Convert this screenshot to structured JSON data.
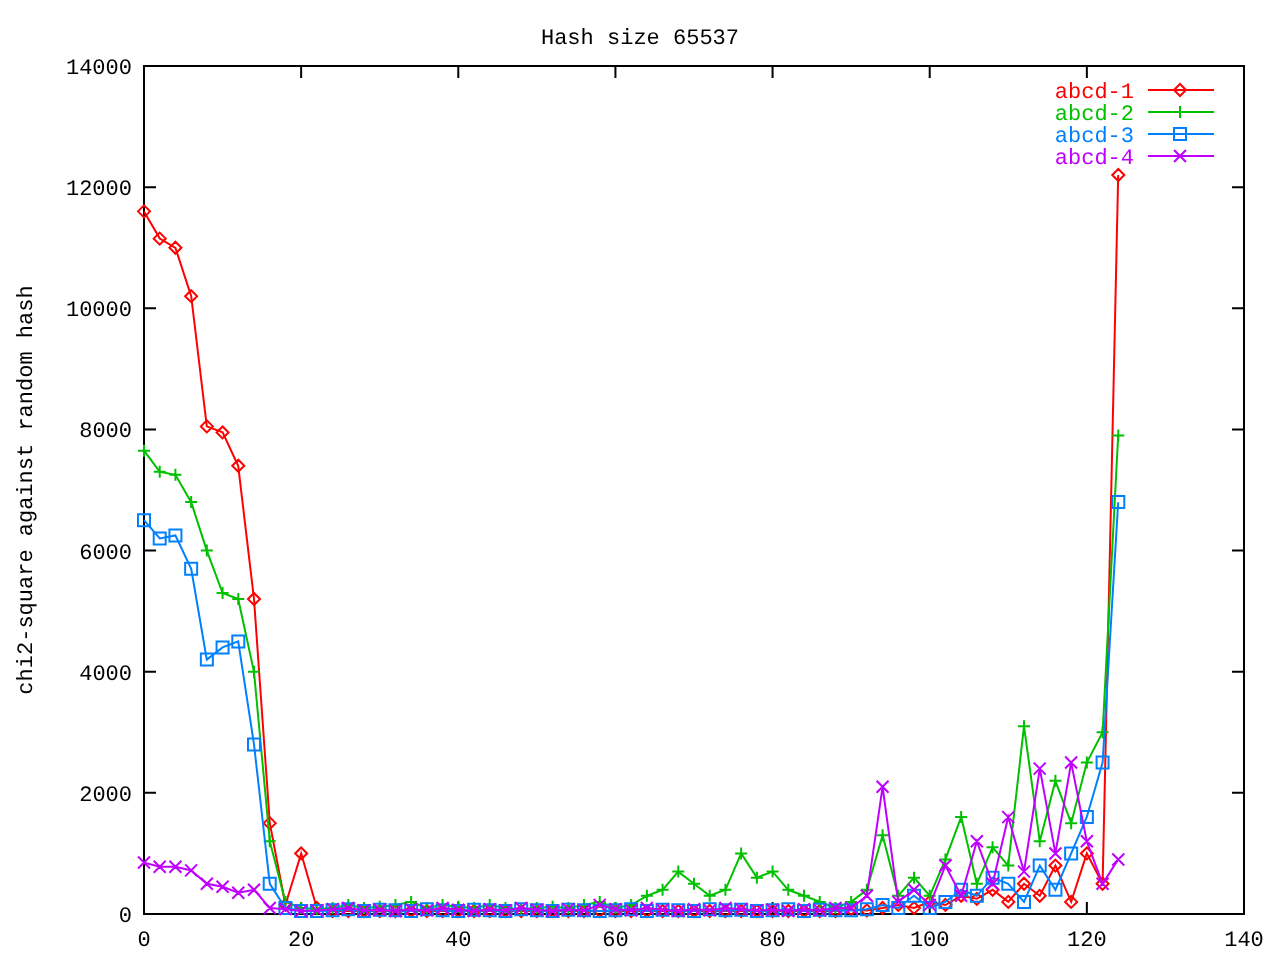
{
  "chart_data": {
    "type": "line",
    "title": "Hash size 65537",
    "ylabel": "chi2-square against random hash",
    "xlim": [
      0,
      140
    ],
    "ylim": [
      0,
      14000
    ],
    "xticks": [
      0,
      20,
      40,
      60,
      80,
      100,
      120,
      140
    ],
    "yticks": [
      0,
      2000,
      4000,
      6000,
      8000,
      10000,
      12000,
      14000
    ],
    "legend": true,
    "x": [
      0,
      2,
      4,
      6,
      8,
      10,
      12,
      14,
      16,
      18,
      20,
      22,
      24,
      26,
      28,
      30,
      32,
      34,
      36,
      38,
      40,
      42,
      44,
      46,
      48,
      50,
      52,
      54,
      56,
      58,
      60,
      62,
      64,
      66,
      68,
      70,
      72,
      74,
      76,
      78,
      80,
      82,
      84,
      86,
      88,
      90,
      92,
      94,
      96,
      98,
      100,
      102,
      104,
      106,
      108,
      110,
      112,
      114,
      116,
      118,
      120,
      122,
      124
    ],
    "series": [
      {
        "name": "abcd-1",
        "color": "#ff0000",
        "marker": "diamond",
        "values": [
          11600,
          11150,
          11000,
          10200,
          8050,
          7950,
          7400,
          5200,
          1500,
          150,
          1000,
          100,
          50,
          50,
          50,
          50,
          50,
          50,
          50,
          50,
          50,
          50,
          50,
          50,
          50,
          50,
          50,
          50,
          50,
          50,
          50,
          50,
          50,
          50,
          50,
          50,
          50,
          50,
          50,
          50,
          50,
          50,
          50,
          50,
          50,
          80,
          60,
          100,
          150,
          100,
          200,
          150,
          300,
          250,
          400,
          200,
          500,
          300,
          800,
          200,
          1000,
          500,
          12200
        ]
      },
      {
        "name": "abcd-2",
        "color": "#00c000",
        "marker": "plus",
        "values": [
          7650,
          7300,
          7250,
          6800,
          6000,
          5300,
          5200,
          4000,
          1200,
          200,
          100,
          80,
          100,
          150,
          100,
          120,
          150,
          200,
          100,
          150,
          120,
          100,
          150,
          100,
          80,
          100,
          120,
          100,
          150,
          200,
          100,
          150,
          300,
          400,
          700,
          500,
          300,
          400,
          1000,
          600,
          700,
          400,
          300,
          200,
          100,
          200,
          400,
          1300,
          300,
          600,
          300,
          900,
          1600,
          500,
          1100,
          800,
          3100,
          1200,
          2200,
          1500,
          2500,
          3000,
          7900
        ]
      },
      {
        "name": "abcd-3",
        "color": "#0080ff",
        "marker": "square",
        "values": [
          6500,
          6200,
          6250,
          5700,
          4200,
          4400,
          4500,
          2800,
          500,
          100,
          50,
          50,
          60,
          80,
          50,
          70,
          60,
          50,
          80,
          60,
          50,
          70,
          60,
          50,
          80,
          60,
          50,
          70,
          60,
          50,
          60,
          80,
          50,
          70,
          60,
          50,
          80,
          60,
          70,
          50,
          60,
          80,
          50,
          70,
          60,
          60,
          80,
          150,
          100,
          300,
          100,
          200,
          400,
          300,
          600,
          500,
          200,
          800,
          400,
          1000,
          1600,
          2500,
          6800
        ]
      },
      {
        "name": "abcd-4",
        "color": "#c000ff",
        "marker": "x",
        "values": [
          850,
          780,
          780,
          720,
          500,
          450,
          350,
          400,
          100,
          80,
          50,
          60,
          80,
          100,
          60,
          70,
          50,
          80,
          60,
          100,
          70,
          50,
          80,
          60,
          100,
          70,
          50,
          80,
          60,
          150,
          80,
          60,
          100,
          70,
          50,
          80,
          60,
          100,
          80,
          60,
          70,
          50,
          80,
          60,
          100,
          100,
          300,
          2100,
          200,
          400,
          150,
          800,
          300,
          1200,
          500,
          1600,
          700,
          2400,
          1000,
          2500,
          1200,
          500,
          900
        ]
      }
    ]
  }
}
